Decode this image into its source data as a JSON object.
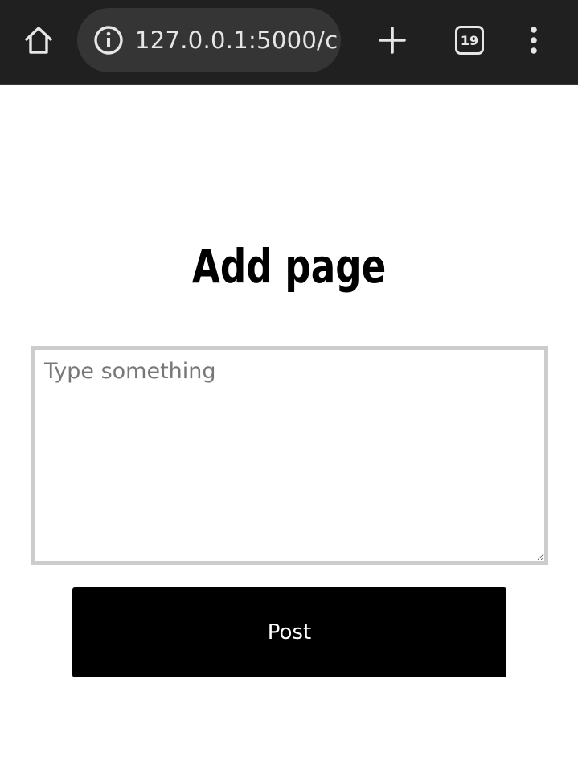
{
  "browser": {
    "url": "127.0.0.1:5000/c",
    "tab_count": "19",
    "icons": {
      "home": "home-icon",
      "info": "info-icon",
      "new_tab": "plus-icon",
      "menu": "more-vert-icon"
    },
    "colors": {
      "toolbar_bg": "#202020",
      "url_box_bg": "#353535",
      "icon_fg": "#e6e6e6"
    }
  },
  "page": {
    "title": "Add page",
    "textarea": {
      "placeholder": "Type something",
      "value": ""
    },
    "post_label": "Post",
    "colors": {
      "button_bg": "#000000",
      "button_fg": "#ffffff",
      "textarea_border": "#cccccc"
    }
  }
}
